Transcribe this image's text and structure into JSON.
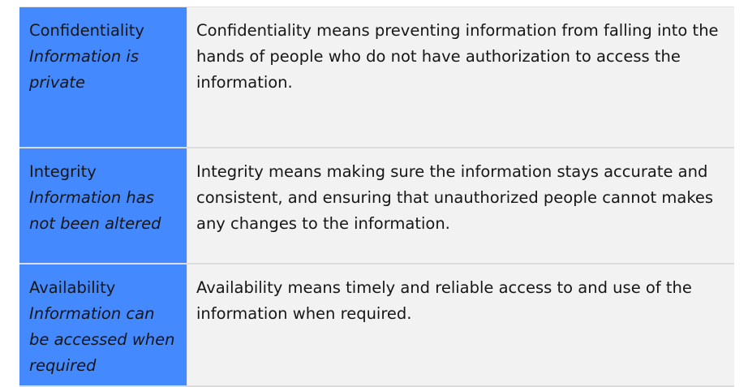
{
  "rows": [
    {
      "term": "Confidentiality",
      "subtitle": "Information is private",
      "description": "Confidentiality means preventing information from falling into the hands of people who do not have authorization to access the information."
    },
    {
      "term": "Integrity",
      "subtitle": "Information has not been altered",
      "description": "Integrity means making sure the information stays accurate and consistent, and ensuring that unauthorized people cannot makes any changes to the information."
    },
    {
      "term": "Availability",
      "subtitle": "Information can be accessed when required",
      "description": "Availability means timely and reliable access to and use of the information when required."
    }
  ],
  "colors": {
    "label_background": "#4589ff",
    "description_background": "#f2f2f2",
    "text": "#161616",
    "divider": "#dcdcdc"
  }
}
